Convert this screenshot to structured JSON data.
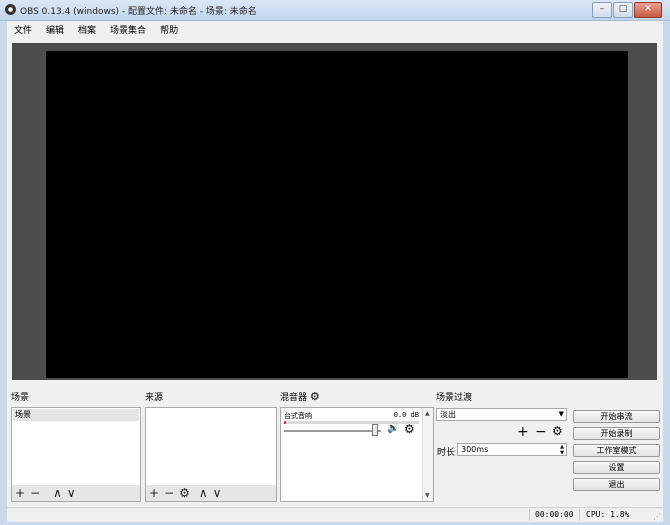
{
  "window": {
    "title": "OBS 0.13.4 (windows) - 配置文件: 未命名 - 场景: 未命名",
    "minimize": "–",
    "maximize": "□",
    "close": "✕"
  },
  "menu": [
    "文件",
    "编辑",
    "档案",
    "场景集合",
    "帮助"
  ],
  "scenes": {
    "title": "场景",
    "items": [
      "场景"
    ],
    "toolbar": [
      "+",
      "−",
      "∧",
      "∨"
    ]
  },
  "sources": {
    "title": "来源",
    "toolbar": [
      "+",
      "−",
      "⚙",
      "∧",
      "∨"
    ]
  },
  "mixer": {
    "title": "混音器",
    "gear": "⚙",
    "channel": {
      "label": "台式音响",
      "db": "0.0 dB",
      "volume_fraction": 0.97,
      "mute_icon": "🔊",
      "gear": "⚙"
    }
  },
  "transitions": {
    "title": "场景过渡",
    "selected": "淡出",
    "add": "+",
    "remove": "−",
    "gear": "⚙",
    "duration_label": "时长",
    "duration_value": "300ms"
  },
  "controls": [
    "开始串流",
    "开始录制",
    "工作室模式",
    "设置",
    "退出"
  ],
  "status": {
    "time": "00:00:00",
    "cpu": "CPU: 1.8%"
  }
}
